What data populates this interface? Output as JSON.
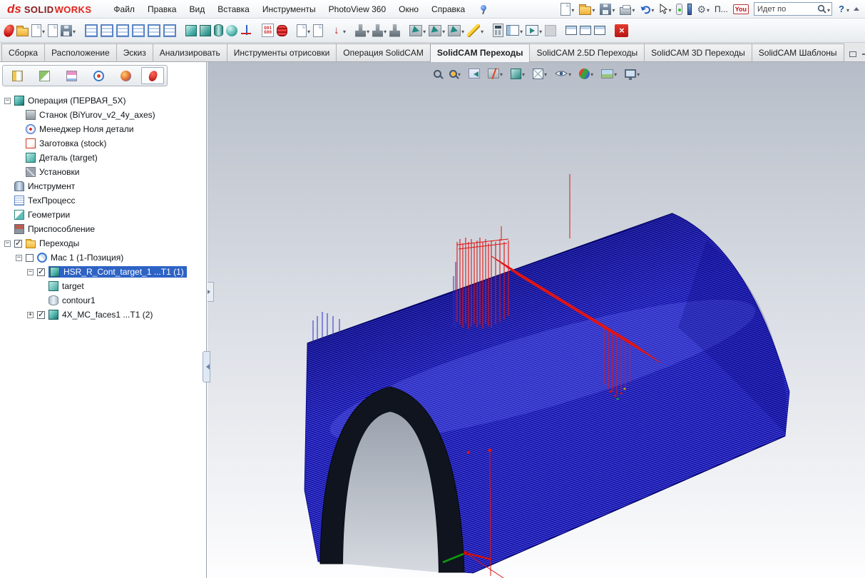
{
  "menubar": {
    "logo": {
      "ds": "ds",
      "solid": "SOLID",
      "works": "WORKS"
    },
    "menus": [
      "Файл",
      "Правка",
      "Вид",
      "Вставка",
      "Инструменты",
      "PhotoView 360",
      "Окно",
      "Справка"
    ],
    "qat": {
      "options_label": "П...",
      "you_label": "You",
      "search_value": "Идет по",
      "help_label": "?"
    }
  },
  "toolbar2": {
    "gcode_line1": "G01",
    "gcode_line2": "G00",
    "icons": [
      "solidcam-part",
      "open-cam-part",
      "new-cam-part",
      "cam-document",
      "save-cam-part",
      "cam-tree-1",
      "cam-tree-2",
      "cam-tree-3",
      "cam-tree-4",
      "cam-tree-5",
      "cam-tree-6",
      "stock-cube",
      "target-cube",
      "cylinder-geometry",
      "sphere-geometry",
      "coordinate-system",
      "gcode-editor",
      "tool-table",
      "goto-operation",
      "mill-tool-1",
      "mill-tool-2",
      "mill-tool-3",
      "machining-1",
      "machining-2",
      "machining-3",
      "edit-operation",
      "calculator",
      "panels",
      "simulation",
      "disabled-tool",
      "window-1",
      "window-2",
      "window-3",
      "close-toolbar"
    ]
  },
  "command_tabs": {
    "items": [
      {
        "label": "Сборка",
        "active": false
      },
      {
        "label": "Расположение",
        "active": false
      },
      {
        "label": "Эскиз",
        "active": false
      },
      {
        "label": "Анализировать",
        "active": false
      },
      {
        "label": "Инструменты отрисовки",
        "active": false
      },
      {
        "label": "Операция SolidCAM",
        "active": false
      },
      {
        "label": "SolidCAM Переходы",
        "active": true
      },
      {
        "label": "SolidCAM 2.5D Переходы",
        "active": false
      },
      {
        "label": "SolidCAM 3D Переходы",
        "active": false
      },
      {
        "label": "SolidCAM Шаблоны",
        "active": false
      }
    ]
  },
  "tree": {
    "items": [
      {
        "label": "Операция (ПЕРВАЯ_5X)"
      },
      {
        "label": "Станок (BiYurov_v2_4y_axes)"
      },
      {
        "label": "Менеджер Ноля детали"
      },
      {
        "label": "Заготовка (stock)"
      },
      {
        "label": "Деталь (target)"
      },
      {
        "label": "Установки"
      },
      {
        "label": "Инструмент"
      },
      {
        "label": "ТехПроцесс"
      },
      {
        "label": "Геометрии"
      },
      {
        "label": "Приспособление"
      },
      {
        "label": "Переходы"
      },
      {
        "label": "Мас 1 (1-Позиция)"
      },
      {
        "label": "HSR_R_Cont_target_1 ...T1 (1)"
      },
      {
        "label": "target"
      },
      {
        "label": "contour1"
      },
      {
        "label": "4X_MC_faces1 ...T1 (2)"
      }
    ]
  },
  "colors": {
    "toolpath_blue": "#2020c8",
    "rapid_red": "#e01414",
    "selection_blue": "#2e63c6",
    "viewport_top": "#b7bdc8"
  }
}
